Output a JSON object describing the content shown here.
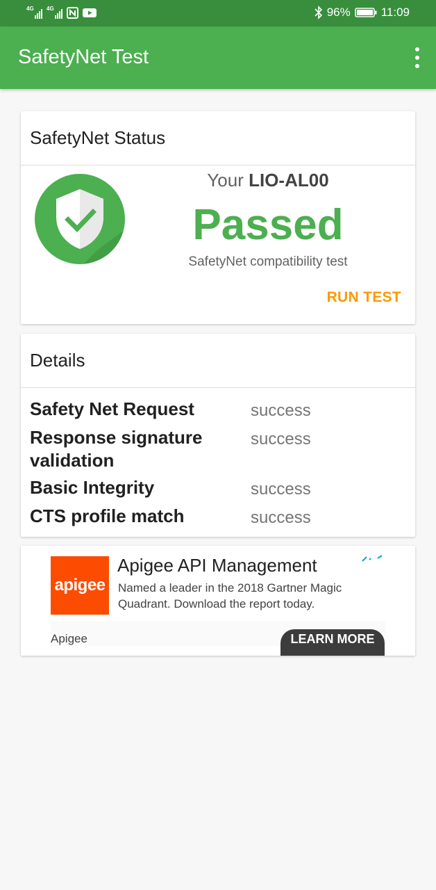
{
  "status_bar": {
    "network_tags": [
      "4G",
      "4G"
    ],
    "battery": "96%",
    "time": "11:09"
  },
  "app_bar": {
    "title": "SafetyNet Test",
    "menu_icon": "more-vert-icon"
  },
  "status_card": {
    "header": "SafetyNet Status",
    "device_prefix": "Your",
    "device_model": "LIO-AL00",
    "result": "Passed",
    "subtitle": "SafetyNet compatibility test",
    "run_test_label": "RUN TEST",
    "shield_icon": "shield-check-icon",
    "colors": {
      "passed": "#4caf50",
      "action": "#ff9800"
    }
  },
  "details_card": {
    "header": "Details",
    "rows": [
      {
        "label": "Safety Net Request",
        "value": "success"
      },
      {
        "label": "Response signature validation",
        "value": "success"
      },
      {
        "label": "Basic Integrity",
        "value": "success"
      },
      {
        "label": "CTS profile match",
        "value": "success"
      }
    ]
  },
  "ad": {
    "logo_text": "apigee",
    "title": "Apigee API Management",
    "description": "Named a leader in the 2018 Gartner Magic Quadrant. Download the report today.",
    "brand": "Apigee",
    "cta": "LEARN MORE"
  }
}
